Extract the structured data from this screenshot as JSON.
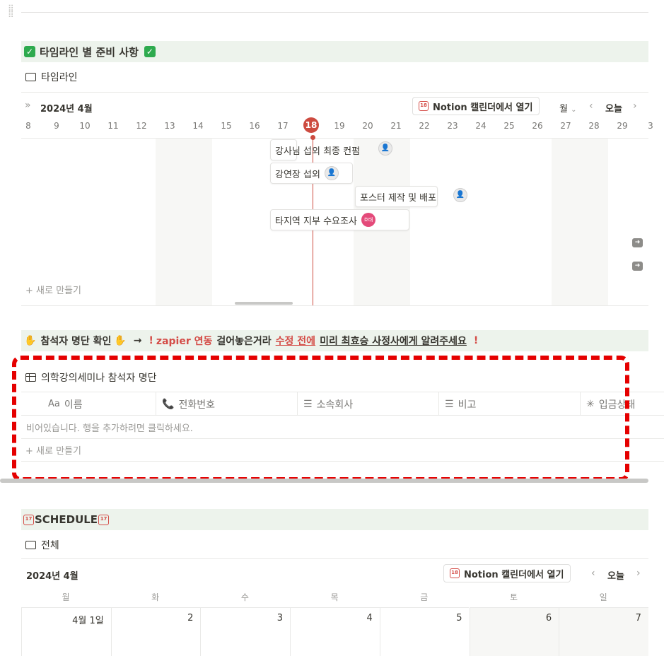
{
  "section1": {
    "title": "타임라인 별 준비 사항",
    "view_label": "타임라인",
    "month": "2024년 4월",
    "open_calendar": "Notion 캘린더에서 열기",
    "view_mode": "월",
    "today": "오늘",
    "days": [
      "8",
      "9",
      "10",
      "11",
      "12",
      "13",
      "14",
      "15",
      "16",
      "17",
      "18",
      "19",
      "20",
      "21",
      "22",
      "23",
      "24",
      "25",
      "26",
      "27",
      "28",
      "29",
      "3"
    ],
    "today_day": "18",
    "tasks": [
      {
        "title": "강사님 섭외 최종 컨펌",
        "avatar": "icon"
      },
      {
        "title": "강연장 섭외",
        "avatar": "icon"
      },
      {
        "title": "포스터 제작 및 배포",
        "avatar": "icon"
      },
      {
        "title": "타지역 지부 수요조사",
        "avatar": "호태"
      }
    ],
    "new_label": "새로 만들기"
  },
  "section2": {
    "prefix": "참석자 명단 확인",
    "arrow": "→",
    "bang": "!",
    "zapier": "zapier 연동",
    "middle": "걸어놓은거라",
    "before_edit": "수정 전에",
    "notice": "미리 최효승 사정사에게 알려주세요",
    "db_title": "의학강의세미나 참석자 명단",
    "columns": [
      {
        "icon": "Aa",
        "label": "이름"
      },
      {
        "icon": "phone-icon",
        "label": "전화번호"
      },
      {
        "icon": "text-icon",
        "label": "소속회사"
      },
      {
        "icon": "text-icon",
        "label": "비고"
      },
      {
        "icon": "status-icon",
        "label": "입금상태"
      }
    ],
    "empty_text": "비어있습니다. 행을 추가하려면 클릭하세요.",
    "new_label": "새로 만들기"
  },
  "section3": {
    "title": "SCHEDULE",
    "view_label": "전체",
    "month": "2024년 4월",
    "open_calendar": "Notion 캘린더에서 열기",
    "today": "오늘",
    "weekdays": [
      "월",
      "화",
      "수",
      "목",
      "금",
      "토",
      "일"
    ],
    "dates": [
      "4월 1일",
      "2",
      "3",
      "4",
      "5",
      "6",
      "7"
    ]
  },
  "colors": {
    "callout_bg": "#edf3ec",
    "today_red": "#cd4b40",
    "warning_red": "#d44c47",
    "annotation_red": "#e50000"
  }
}
